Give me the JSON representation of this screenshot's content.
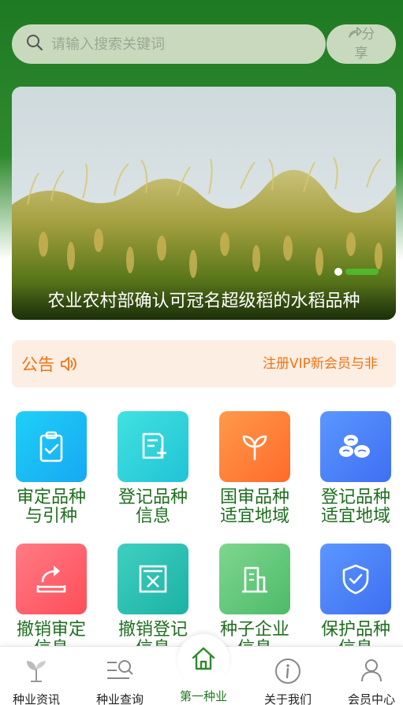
{
  "header": {
    "search_placeholder": "请输入搜索关键词",
    "share_label_line1": "分",
    "share_label_line2": "享"
  },
  "banner": {
    "caption": "农业农村部确认可冠名超级稻的水稻品种",
    "slide_count": 2,
    "active_slide": 2
  },
  "notice": {
    "title": "公告",
    "text": "注册VIP新会员与非"
  },
  "grid": [
    {
      "line1": "审定品种",
      "line2": "与引种",
      "icon": "clipboard-check-icon",
      "color1": "#1fd0f6",
      "color2": "#17a8f4"
    },
    {
      "line1": "登记品种",
      "line2": "信息",
      "icon": "document-add-icon",
      "color1": "#41e2e0",
      "color2": "#21c3d6"
    },
    {
      "line1": "国审品种",
      "line2": "适宜地域",
      "icon": "sprout-icon",
      "color1": "#ff9a4a",
      "color2": "#ff6a2a"
    },
    {
      "line1": "登记品种",
      "line2": "适宜地域",
      "icon": "seeds-icon",
      "color1": "#5b97ff",
      "color2": "#3f6ff2"
    },
    {
      "line1": "撤销审定",
      "line2": "信息",
      "icon": "undo-tray-icon",
      "color1": "#ff7b84",
      "color2": "#ff4e5a"
    },
    {
      "line1": "撤销登记",
      "line2": "信息",
      "icon": "cancel-box-icon",
      "color1": "#3fcfc0",
      "color2": "#1cb2a5"
    },
    {
      "line1": "种子企业",
      "line2": "信息",
      "icon": "building-icon",
      "color1": "#7fd68e",
      "color2": "#4cbb6a"
    },
    {
      "line1": "保护品种",
      "line2": "信息",
      "icon": "shield-check-icon",
      "color1": "#5b97ff",
      "color2": "#3f6ff2"
    }
  ],
  "tabs": [
    {
      "label": "种业资讯",
      "icon": "plant-icon"
    },
    {
      "label": "种业查询",
      "icon": "search-list-icon"
    },
    {
      "label": "第一种业",
      "icon": "home-icon"
    },
    {
      "label": "关于我们",
      "icon": "info-icon"
    },
    {
      "label": "会员中心",
      "icon": "user-icon"
    }
  ],
  "colors": {
    "brand_green": "#1e7a23",
    "notice_orange": "#f07414",
    "label_green": "#1f6e1f"
  }
}
